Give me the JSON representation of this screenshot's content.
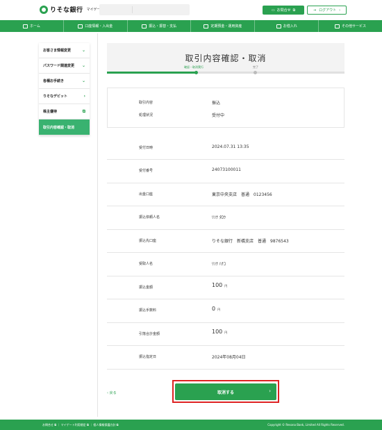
{
  "header": {
    "logo": "りそな銀行",
    "logo_sub": "マイゲート",
    "contact": "お問合せ",
    "logout": "ログアウト"
  },
  "nav": [
    {
      "label": "ホーム",
      "icon": "home-icon"
    },
    {
      "label": "口座情報・入出金",
      "icon": "account-icon"
    },
    {
      "label": "振込・振替・支払",
      "icon": "transfer-icon"
    },
    {
      "label": "定期預金・運用資産",
      "icon": "deposit-icon"
    },
    {
      "label": "お借入れ",
      "icon": "loan-icon"
    },
    {
      "label": "その他サービス",
      "icon": "services-icon"
    }
  ],
  "sidebar": [
    {
      "label": "お客さま情報変更",
      "chev": "⌄"
    },
    {
      "label": "パスワード関連変更",
      "chev": "⌄"
    },
    {
      "label": "各種お手続き",
      "chev": "⌄"
    },
    {
      "label": "りそなデビット",
      "chev": "›"
    },
    {
      "label": "株主優待",
      "chev": "⧉"
    },
    {
      "label": "取引内容確認・取消",
      "chev": ""
    }
  ],
  "page": {
    "title": "取引内容確認・取消",
    "step1": "確認・取消実行",
    "step2": "完了"
  },
  "summary": {
    "k1": "取引内容",
    "v1": "振込",
    "k2": "処理状況",
    "v2": "受付中"
  },
  "details": [
    {
      "key": "受付日時",
      "value": "2024.07.31 13:35"
    },
    {
      "key": "受付番号",
      "value": "24073100011"
    },
    {
      "key": "出金口座",
      "value": "東京中央支店　普通　0123456"
    },
    {
      "key": "振込依頼人名",
      "value": "ﾘｿﾅ ﾀﾛｳ"
    },
    {
      "key": "振込先口座",
      "value": "りそな銀行　新橋支店　普通　9876543"
    },
    {
      "key": "受取人名",
      "value": "ﾘｿﾅ ﾊﾅｺ"
    },
    {
      "key": "振込金額",
      "value": "100",
      "unit": "円"
    },
    {
      "key": "振込手数料",
      "value": "0",
      "unit": "円"
    },
    {
      "key": "引落合計金額",
      "value": "100",
      "unit": "円"
    },
    {
      "key": "振込指定日",
      "value": "2024年08月04日"
    }
  ],
  "actions": {
    "back": "戻る",
    "cancel": "取消する"
  },
  "footer": {
    "links": "お問合せ ⧉ ｜ マイゲート利用規定 ⧉ ｜ 個人情報保護方針 ⧉",
    "copyright": "Copyright © Resona Bank, Limited All Rights Reserved."
  },
  "colors": {
    "brand": "#2aa150",
    "highlight": "#dd2222"
  }
}
